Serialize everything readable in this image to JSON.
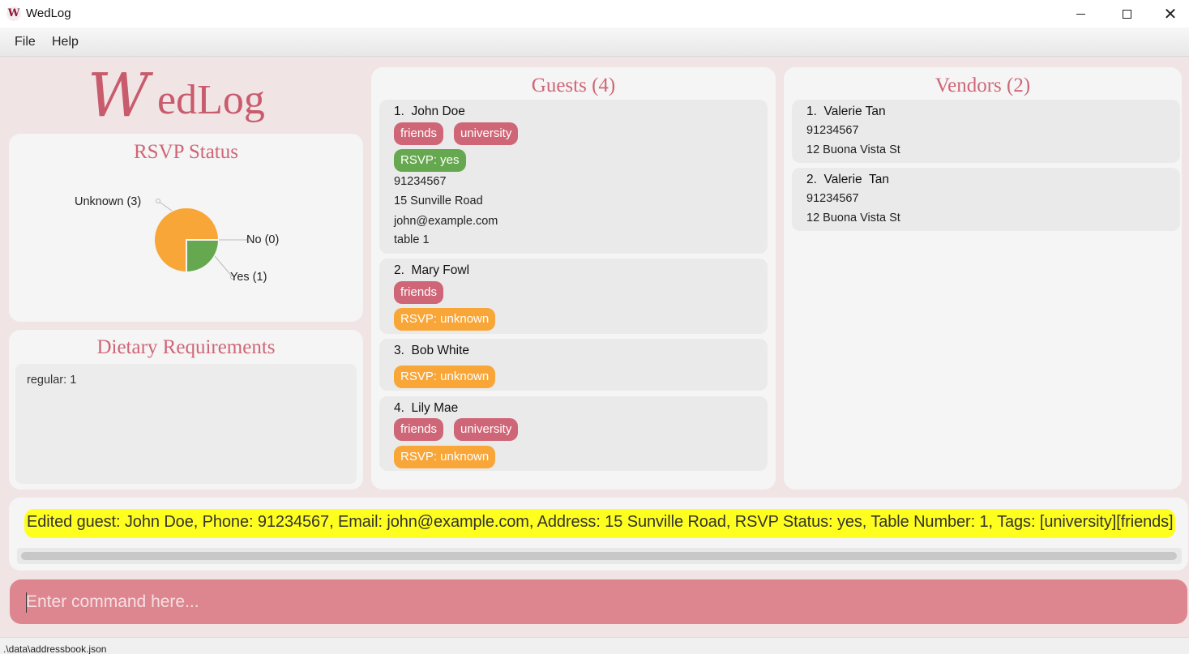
{
  "window": {
    "icon_glyph": "W",
    "title": "WedLog",
    "controls": [
      "minimize-icon",
      "maximize-icon",
      "close-icon"
    ],
    "close_glyph": "✕"
  },
  "menu": {
    "file": "File",
    "help": "Help"
  },
  "logo": {
    "first_letter": "W",
    "rest": "edLog"
  },
  "rsvp": {
    "title": "RSVP Status",
    "labels": {
      "unknown": "Unknown (3)",
      "no": "No (0)",
      "yes": "Yes (1)"
    },
    "chart_data": {
      "type": "pie",
      "title": "RSVP Status",
      "categories": [
        "Unknown",
        "No",
        "Yes"
      ],
      "values": [
        3,
        0,
        1
      ],
      "colors": [
        "#f9a638",
        "#cf6677",
        "#66a84f"
      ]
    }
  },
  "dietary": {
    "title": "Dietary Requirements",
    "lines": [
      "regular: 1"
    ]
  },
  "guests": {
    "title": "Guests (4)",
    "items": [
      {
        "name": "1.  John Doe",
        "tags": [
          "friends",
          "university"
        ],
        "rsvp": "RSVP: yes",
        "phone": "91234567",
        "address": "15 Sunville Road",
        "email": "john@example.com",
        "table": "table 1"
      },
      {
        "name": "2.  Mary Fowl",
        "tags": [
          "friends"
        ],
        "rsvp": "RSVP: unknown"
      },
      {
        "name": "3.  Bob White",
        "tags": [],
        "rsvp": "RSVP: unknown"
      },
      {
        "name": "4.  Lily Mae",
        "tags": [
          "friends",
          "university"
        ],
        "rsvp": "RSVP: unknown"
      }
    ]
  },
  "vendors": {
    "title": "Vendors (2)",
    "items": [
      {
        "name": "1.  Valerie Tan",
        "phone": "91234567",
        "address": "12 Buona Vista St"
      },
      {
        "name": "2.  Valerie  Tan",
        "phone": "91234567",
        "address": "12 Buona Vista St"
      }
    ]
  },
  "result": {
    "text": "Edited guest: John Doe, Phone: 91234567, Email: john@example.com, Address: 15 Sunville Road, RSVP Status: yes, Table Number: 1, Tags: [university][friends]"
  },
  "command": {
    "placeholder": "Enter command here...",
    "value": ""
  },
  "status": {
    "path": ".\\data\\addressbook.json"
  },
  "colors": {
    "accent": "#cf6677",
    "rsvp_yes": "#66a84f",
    "rsvp_unknown": "#f9a638",
    "command_bg": "#de868f",
    "highlight": "#ffff1f"
  }
}
